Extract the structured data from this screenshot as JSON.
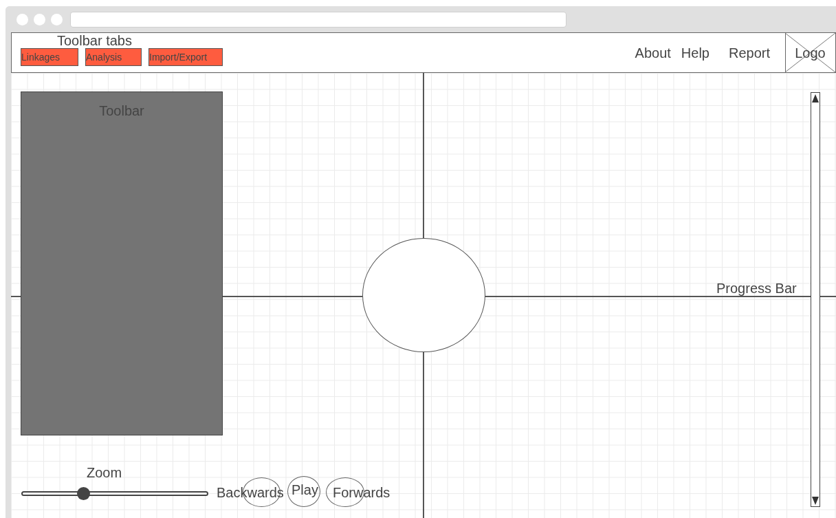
{
  "header": {
    "title": "Toolbar tabs",
    "tabs": [
      {
        "label": "Linkages"
      },
      {
        "label": "Analysis"
      },
      {
        "label": "Import/Export"
      }
    ],
    "nav": [
      "About",
      "Help",
      "Report"
    ],
    "logo": "Logo"
  },
  "canvas": {
    "toolbar": {
      "title": "Toolbar"
    },
    "progress_bar": {
      "label": "Progress Bar",
      "level": 0
    },
    "zoom": {
      "label": "Zoom",
      "level": 0.33
    },
    "playback": [
      "Backwards",
      "Play",
      "Forwards"
    ]
  }
}
